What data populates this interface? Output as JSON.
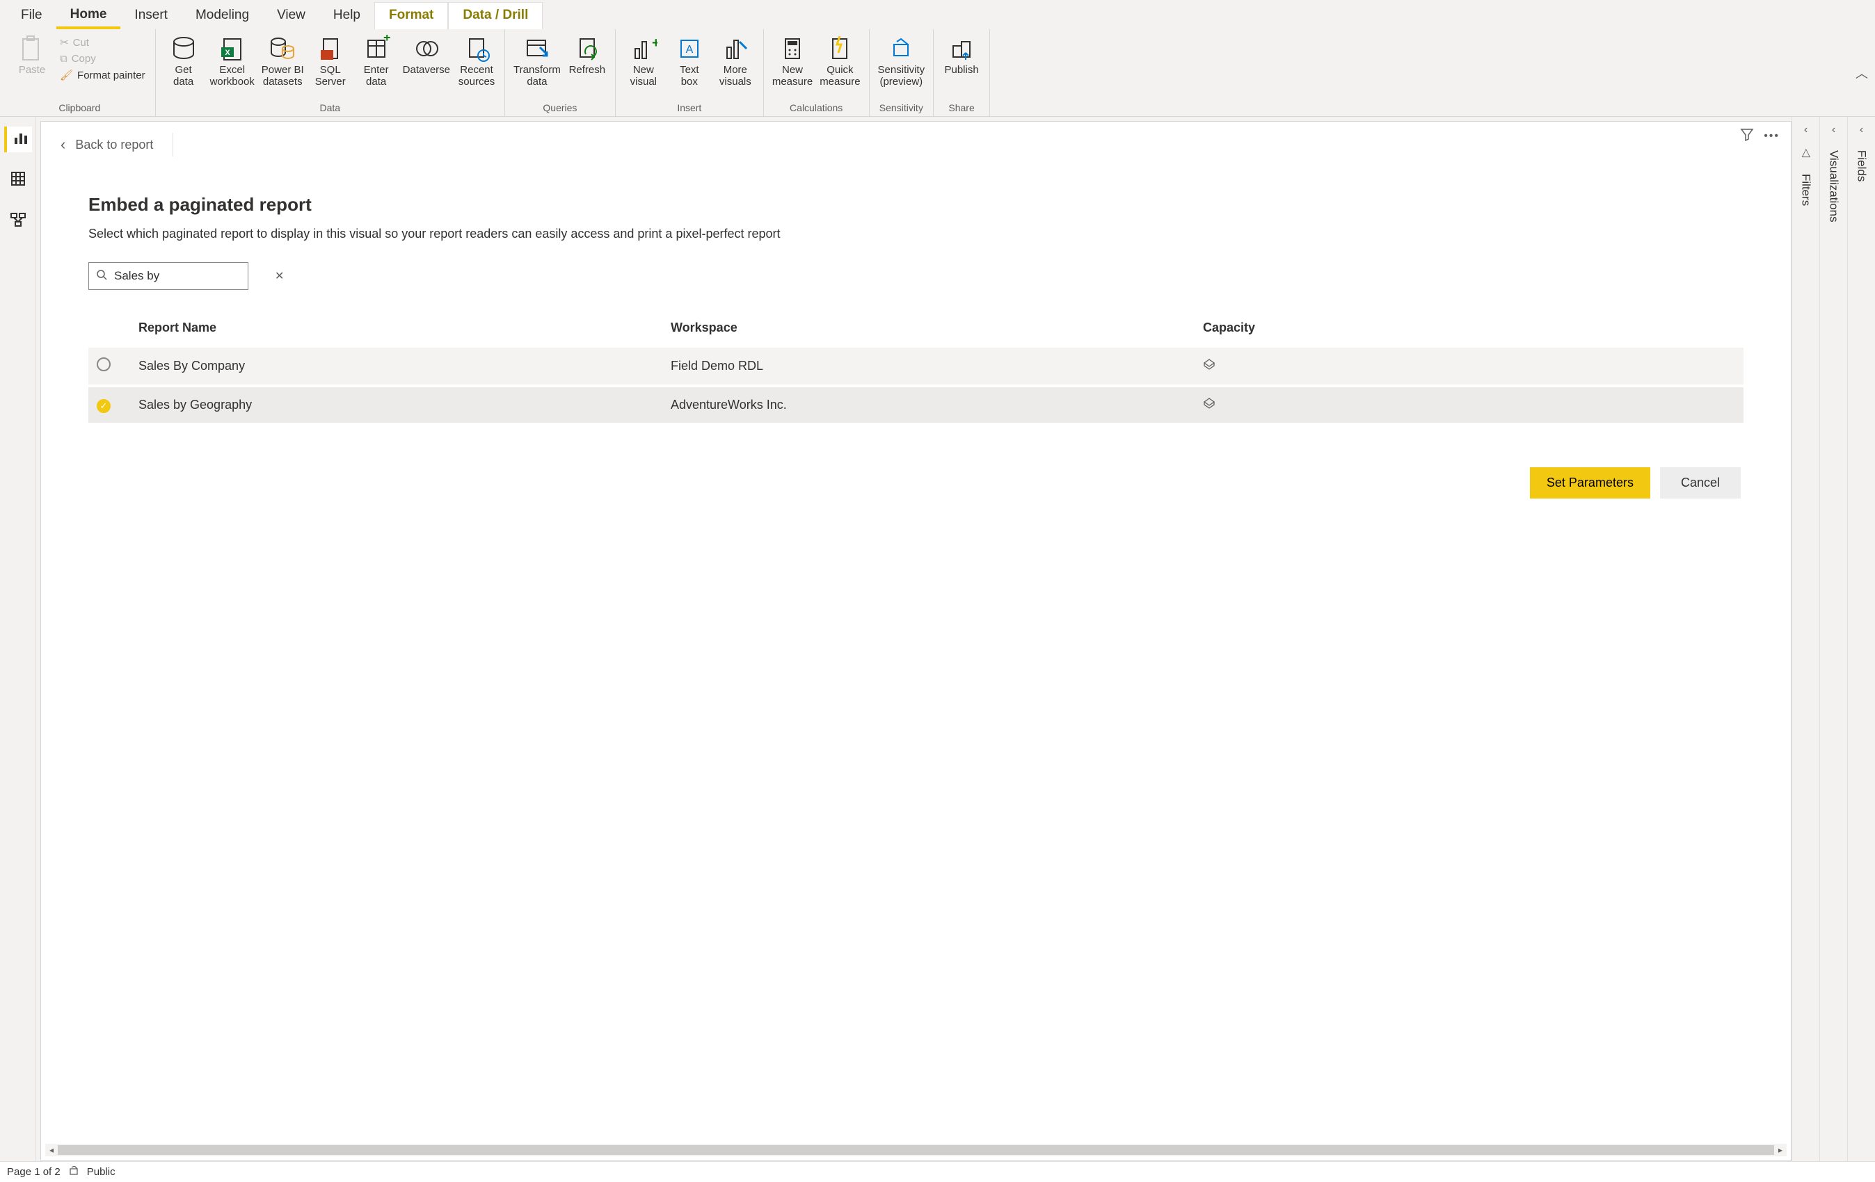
{
  "menubar": {
    "items": [
      "File",
      "Home",
      "Insert",
      "Modeling",
      "View",
      "Help",
      "Format",
      "Data / Drill"
    ],
    "active": "Home",
    "special": [
      "Format",
      "Data / Drill"
    ]
  },
  "ribbon": {
    "clipboard": {
      "paste": "Paste",
      "cut": "Cut",
      "copy": "Copy",
      "format_painter": "Format painter",
      "group_label": "Clipboard"
    },
    "data": {
      "get_data": "Get\ndata",
      "excel": "Excel\nworkbook",
      "pbi_datasets": "Power BI\ndatasets",
      "sql": "SQL\nServer",
      "enter_data": "Enter\ndata",
      "dataverse": "Dataverse",
      "recent": "Recent\nsources",
      "group_label": "Data"
    },
    "queries": {
      "transform": "Transform\ndata",
      "refresh": "Refresh",
      "group_label": "Queries"
    },
    "insert": {
      "new_visual": "New\nvisual",
      "text_box": "Text\nbox",
      "more_visuals": "More\nvisuals",
      "group_label": "Insert"
    },
    "calculations": {
      "new_measure": "New\nmeasure",
      "quick_measure": "Quick\nmeasure",
      "group_label": "Calculations"
    },
    "sensitivity": {
      "label": "Sensitivity\n(preview)",
      "group_label": "Sensitivity"
    },
    "share": {
      "publish": "Publish",
      "group_label": "Share"
    }
  },
  "leftRail": {
    "report_view": "report-view",
    "data_view": "data-view",
    "model_view": "model-view"
  },
  "canvas": {
    "back": "Back to report",
    "title": "Embed a paginated report",
    "subtitle": "Select which paginated report to display in this visual so your report readers can easily access and print a pixel-perfect report",
    "search_value": "Sales by",
    "columns": {
      "name": "Report Name",
      "workspace": "Workspace",
      "capacity": "Capacity"
    },
    "rows": [
      {
        "selected": false,
        "name": "Sales By Company",
        "workspace": "Field Demo RDL"
      },
      {
        "selected": true,
        "name": "Sales by Geography",
        "workspace": "AdventureWorks Inc."
      }
    ],
    "actions": {
      "set_parameters": "Set Parameters",
      "cancel": "Cancel"
    }
  },
  "rightPanes": {
    "filters": "Filters",
    "visualizations": "Visualizations",
    "fields": "Fields"
  },
  "statusbar": {
    "page": "Page 1 of 2",
    "sensitivity": "Public"
  }
}
